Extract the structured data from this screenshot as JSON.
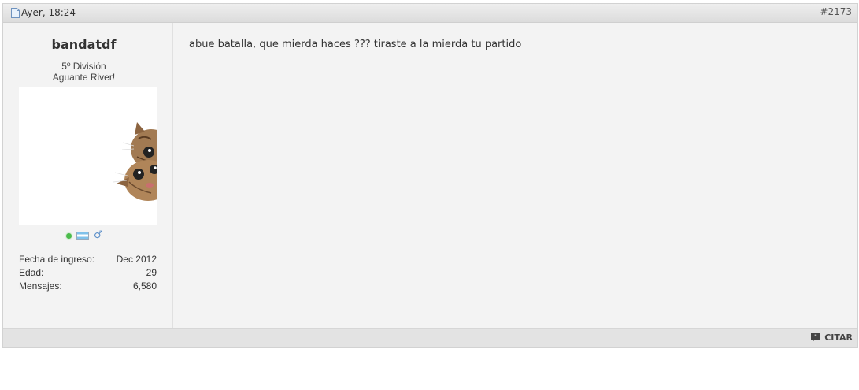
{
  "post": {
    "date": "Ayer, 18:24",
    "number": "#2173",
    "message": "abue batalla, que mierda haces ??? tiraste a la mierda tu partido"
  },
  "user": {
    "name": "bandatdf",
    "rank": "5º División",
    "title": "Aguante River!",
    "avatar_icon": "cat-peeking-image",
    "status_icons": [
      "online-icon",
      "argentina-flag-icon",
      "male-icon"
    ],
    "stats": [
      {
        "label": "Fecha de ingreso:",
        "value": "Dec 2012"
      },
      {
        "label": "Edad:",
        "value": "29"
      },
      {
        "label": "Mensajes:",
        "value": "6,580"
      }
    ]
  },
  "footer": {
    "quote_label": "CITAR"
  },
  "colors": {
    "header_bg": "#dcdcdc",
    "post_bg": "#f3f3f3",
    "online": "#4cbc4c"
  }
}
